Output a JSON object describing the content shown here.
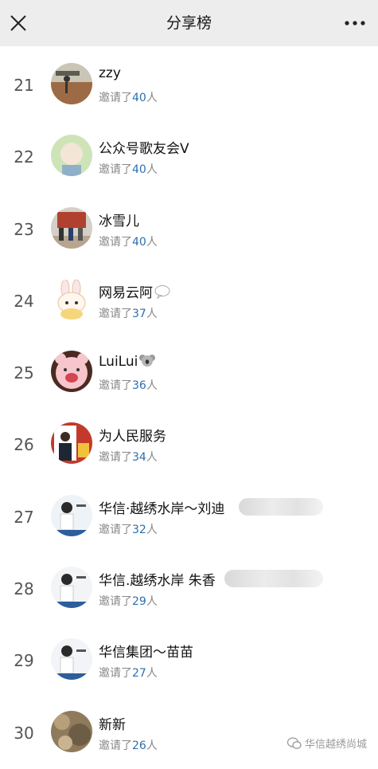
{
  "header": {
    "title": "分享榜",
    "close_icon": "close-icon",
    "more_icon": "more-dots-icon"
  },
  "invite": {
    "prefix": "邀请了",
    "suffix": "人"
  },
  "rows": [
    {
      "rank": "21",
      "name": "zzy",
      "count": "40"
    },
    {
      "rank": "22",
      "name": "公众号歌友会V",
      "count": "40"
    },
    {
      "rank": "23",
      "name": "冰雪儿",
      "count": "40"
    },
    {
      "rank": "24",
      "name": "网易云阿",
      "count": "37",
      "icon": "speech-bubble-icon"
    },
    {
      "rank": "25",
      "name": "LuiLui",
      "count": "36",
      "icon": "koala-icon"
    },
    {
      "rank": "26",
      "name": "为人民服务",
      "count": "34"
    },
    {
      "rank": "27",
      "name": "华信·越绣水岸～刘迪",
      "count": "32"
    },
    {
      "rank": "28",
      "name": "华信.越绣水岸 朱香",
      "count": "29"
    },
    {
      "rank": "29",
      "name": "华信集团～苗苗",
      "count": "27"
    },
    {
      "rank": "30",
      "name": "新新",
      "count": "26"
    }
  ],
  "watermark": {
    "text": "华信越绣尚城"
  },
  "colors": {
    "header_bg": "#ededed",
    "count": "#2d6fb0",
    "rank": "#555555"
  }
}
